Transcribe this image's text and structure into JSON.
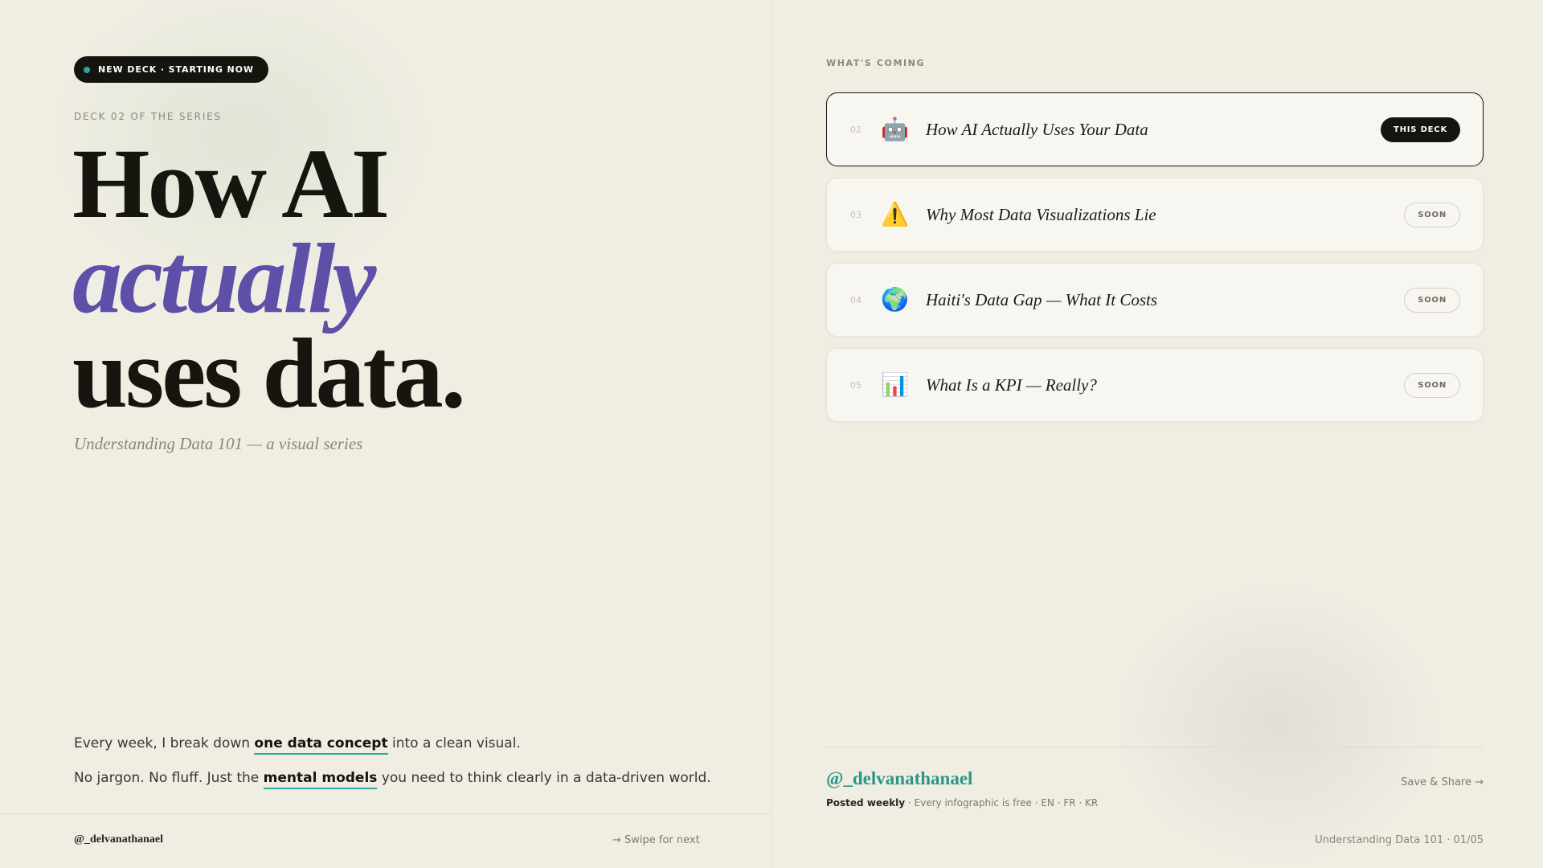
{
  "left": {
    "badge": "NEW DECK · STARTING NOW",
    "eyebrow": "DECK 02 OF THE SERIES",
    "headline": {
      "line1": "How AI",
      "line2": "actually",
      "line3": "uses data."
    },
    "subtitle": "Understanding Data 101 — a visual series",
    "body": {
      "p1_before": "Every week, I break down ",
      "p1_highlight": "one data concept",
      "p1_after": " into a clean visual.",
      "p2_before": "No jargon. No fluff. Just the ",
      "p2_highlight": "mental models",
      "p2_after": " you need to think clearly in a data-driven world."
    },
    "footer": {
      "handle": "@_delvanathanael",
      "swipe": "→ Swipe for next"
    }
  },
  "right": {
    "section_label": "WHAT'S COMING",
    "cards": [
      {
        "num": "02",
        "emoji": "🤖",
        "title": "How AI Actually Uses Your Data",
        "tag": "THIS DECK"
      },
      {
        "num": "03",
        "emoji": "⚠️",
        "title": "Why Most Data Visualizations Lie",
        "tag": "SOON"
      },
      {
        "num": "04",
        "emoji": "🌍",
        "title": "Haiti's Data Gap — What It Costs",
        "tag": "SOON"
      },
      {
        "num": "05",
        "emoji": "📊",
        "title": "What Is a KPI — Really?",
        "tag": "SOON"
      }
    ],
    "footer": {
      "handle": "@_delvanathanael",
      "posted_bold": "Posted weekly",
      "posted_rest": " · Every infographic is free · EN · FR · KR",
      "save_share": "Save & Share →",
      "series_page": "Understanding Data 101 · 01/05"
    }
  },
  "colors": {
    "background": "#f0ede3",
    "accent_purple": "#5e4fa8",
    "accent_teal": "#2ea79a",
    "ink": "#17150f"
  }
}
